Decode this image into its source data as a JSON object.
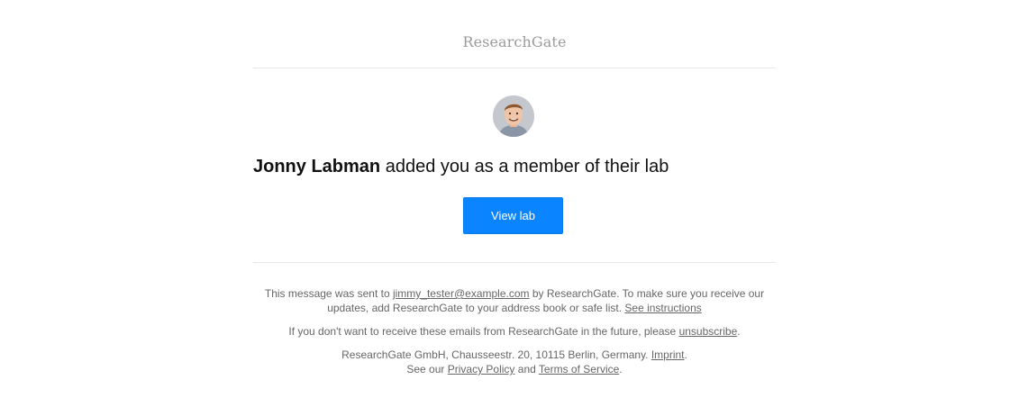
{
  "header": {
    "brand": "ResearchGate"
  },
  "notification": {
    "actor_name": "Jonny Labman",
    "message": " added you as a member of their lab",
    "button_label": "View lab"
  },
  "footer": {
    "sent_prefix": "This message was sent to ",
    "email": "jimmy_tester@example.com",
    "sent_suffix": " by ResearchGate. To make sure you receive our updates, add ResearchGate to your address book or safe list. ",
    "instructions_link": "See instructions",
    "unsub_prefix": "If you don't want to receive these emails from ResearchGate in the future, please ",
    "unsubscribe_link": "unsubscribe",
    "unsub_suffix": ".",
    "address": "ResearchGate GmbH, Chausseestr. 20, 10115 Berlin, Germany. ",
    "imprint_link": "Imprint",
    "imprint_suffix": ".",
    "see_our": "See our ",
    "privacy_link": "Privacy Policy",
    "and": " and ",
    "terms_link": "Terms of Service",
    "terms_suffix": "."
  },
  "colors": {
    "button": "#0a84ff",
    "brand": "#9a9a9a",
    "footer_text": "#666666"
  },
  "icons": {
    "avatar": "user-avatar-photo"
  }
}
